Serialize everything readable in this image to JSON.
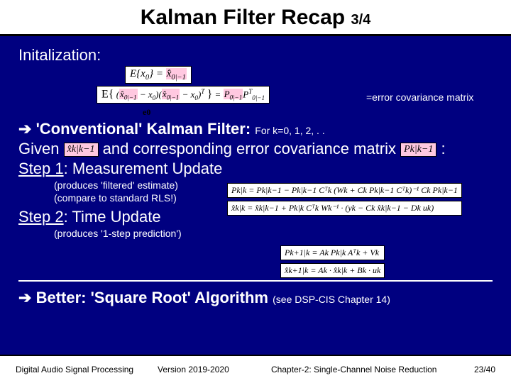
{
  "header": {
    "title": "Kalman Filter Recap",
    "sub": "3/4"
  },
  "init": {
    "label": "Initalization:",
    "eq1_lhs": "E{x",
    "eq1_sub": "0",
    "eq1_mid": "} = ",
    "eq1_rhs": "x̂",
    "eq1_rhs_sub": "0|−1",
    "eq2": "E{ (x̂0|−1 − x0)(x̂0|−1 − x0)ᵀ } = P0|−1 P0|−1ᵀ",
    "e0": "e0",
    "errcov": "=error covariance matrix"
  },
  "conv": {
    "arrow": "➔",
    "title": "'Conventional' Kalman Filter:",
    "fork": "For k=0, 1, 2, . .",
    "given_a": "Given",
    "xhat": "x̂k|k−1",
    "given_b": "and corresponding error covariance matrix",
    "pk": "Pk|k−1",
    "given_c": ":",
    "step1": "Step 1",
    "step1_rest": ": Measurement Update",
    "note1": "(produces 'filtered' estimate)",
    "note2": "(compare to standard RLS!)",
    "step2": "Step 2",
    "step2_rest": ": Time Update",
    "note3": "(produces '1-step prediction')"
  },
  "eqs": {
    "mu1": "Pk|k = Pk|k−1 − Pk|k−1 Cᵀk (Wk + Ck Pk|k−1 Cᵀk)⁻¹ Ck Pk|k−1",
    "mu2": "x̂k|k = x̂k|k−1 + Pk|k Cᵀk Wk⁻¹ · (yk − Ck x̂k|k−1 − Dk uk)",
    "tu1": "Pk+1|k = Ak Pk|k Aᵀk + Vk",
    "tu2": "x̂k+1|k = Ak · x̂k|k + Bk · uk"
  },
  "better": {
    "arrow": "➔",
    "label": "Better: 'Square Root' Algorithm",
    "note": "(see DSP-CIS Chapter 14)"
  },
  "footer": {
    "left": "Digital Audio Signal Processing",
    "mid": "Version 2019-2020",
    "right": "Chapter-2: Single-Channel Noise Reduction",
    "page": "23/40"
  }
}
